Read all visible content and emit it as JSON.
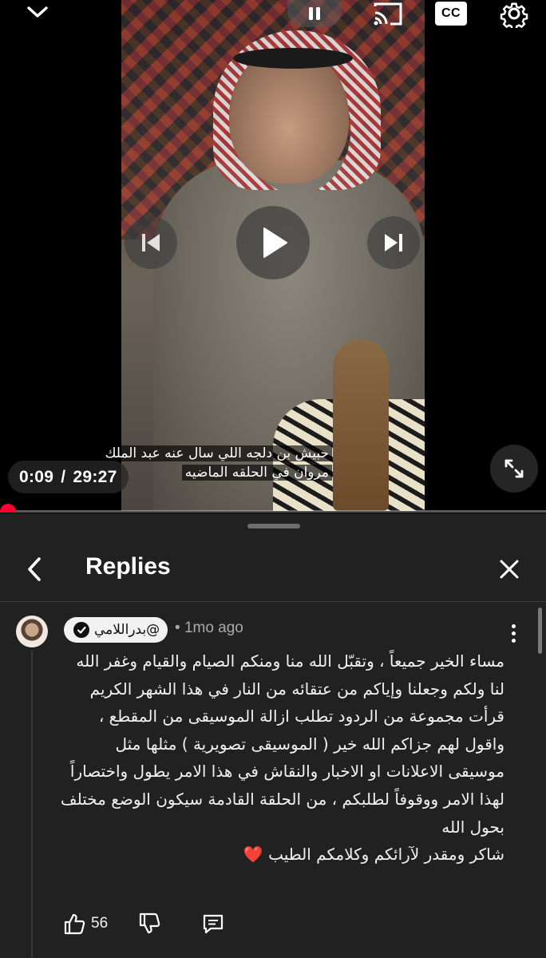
{
  "player": {
    "subtitle_line1": "حبيش بن دلجه اللي سال عنه عبد الملك",
    "subtitle_line2": "مروان في الحلقه الماضيه",
    "current_time": "0:09",
    "time_separator": "/",
    "duration": "29:27",
    "progress_fraction": 0.005,
    "accent_color": "#ff0033",
    "cc_label": "CC",
    "icons": {
      "collapse": "chevron-down-icon",
      "pause": "pause-icon",
      "cast": "cast-icon",
      "captions": "cc-icon",
      "settings": "gear-icon",
      "previous": "skip-previous-icon",
      "play": "play-icon",
      "next": "skip-next-icon",
      "fullscreen": "fullscreen-icon"
    }
  },
  "panel": {
    "title": "Replies",
    "comment": {
      "author": "@بدراللامي",
      "verified": true,
      "time_ago": "1mo ago",
      "bullet": "•",
      "paragraphs": [
        "مساء الخير جميعاً ، وتقبّل الله منا ومنكم الصيام والقيام وغفر الله لنا ولكم وجعلنا وإياكم من عتقائه من النار في هذا الشهر الكريم",
        "قرأت مجموعة من الردود تطلب ازالة الموسيقى من المقطع ، واقول لهم جزاكم الله خير ( الموسيقى تصويرية ) مثلها مثل موسيقى الاعلانات او الاخبار والنقاش في هذا الامر يطول واختصاراً لهذا الامر ووقوفاً لطلبكم ، من الحلقة القادمة سيكون الوضع مختلف بحول الله",
        "شاكر ومقدر لآرائكم وكلامكم الطيب"
      ],
      "closing_emoji": "❤️",
      "like_count": "56"
    }
  }
}
